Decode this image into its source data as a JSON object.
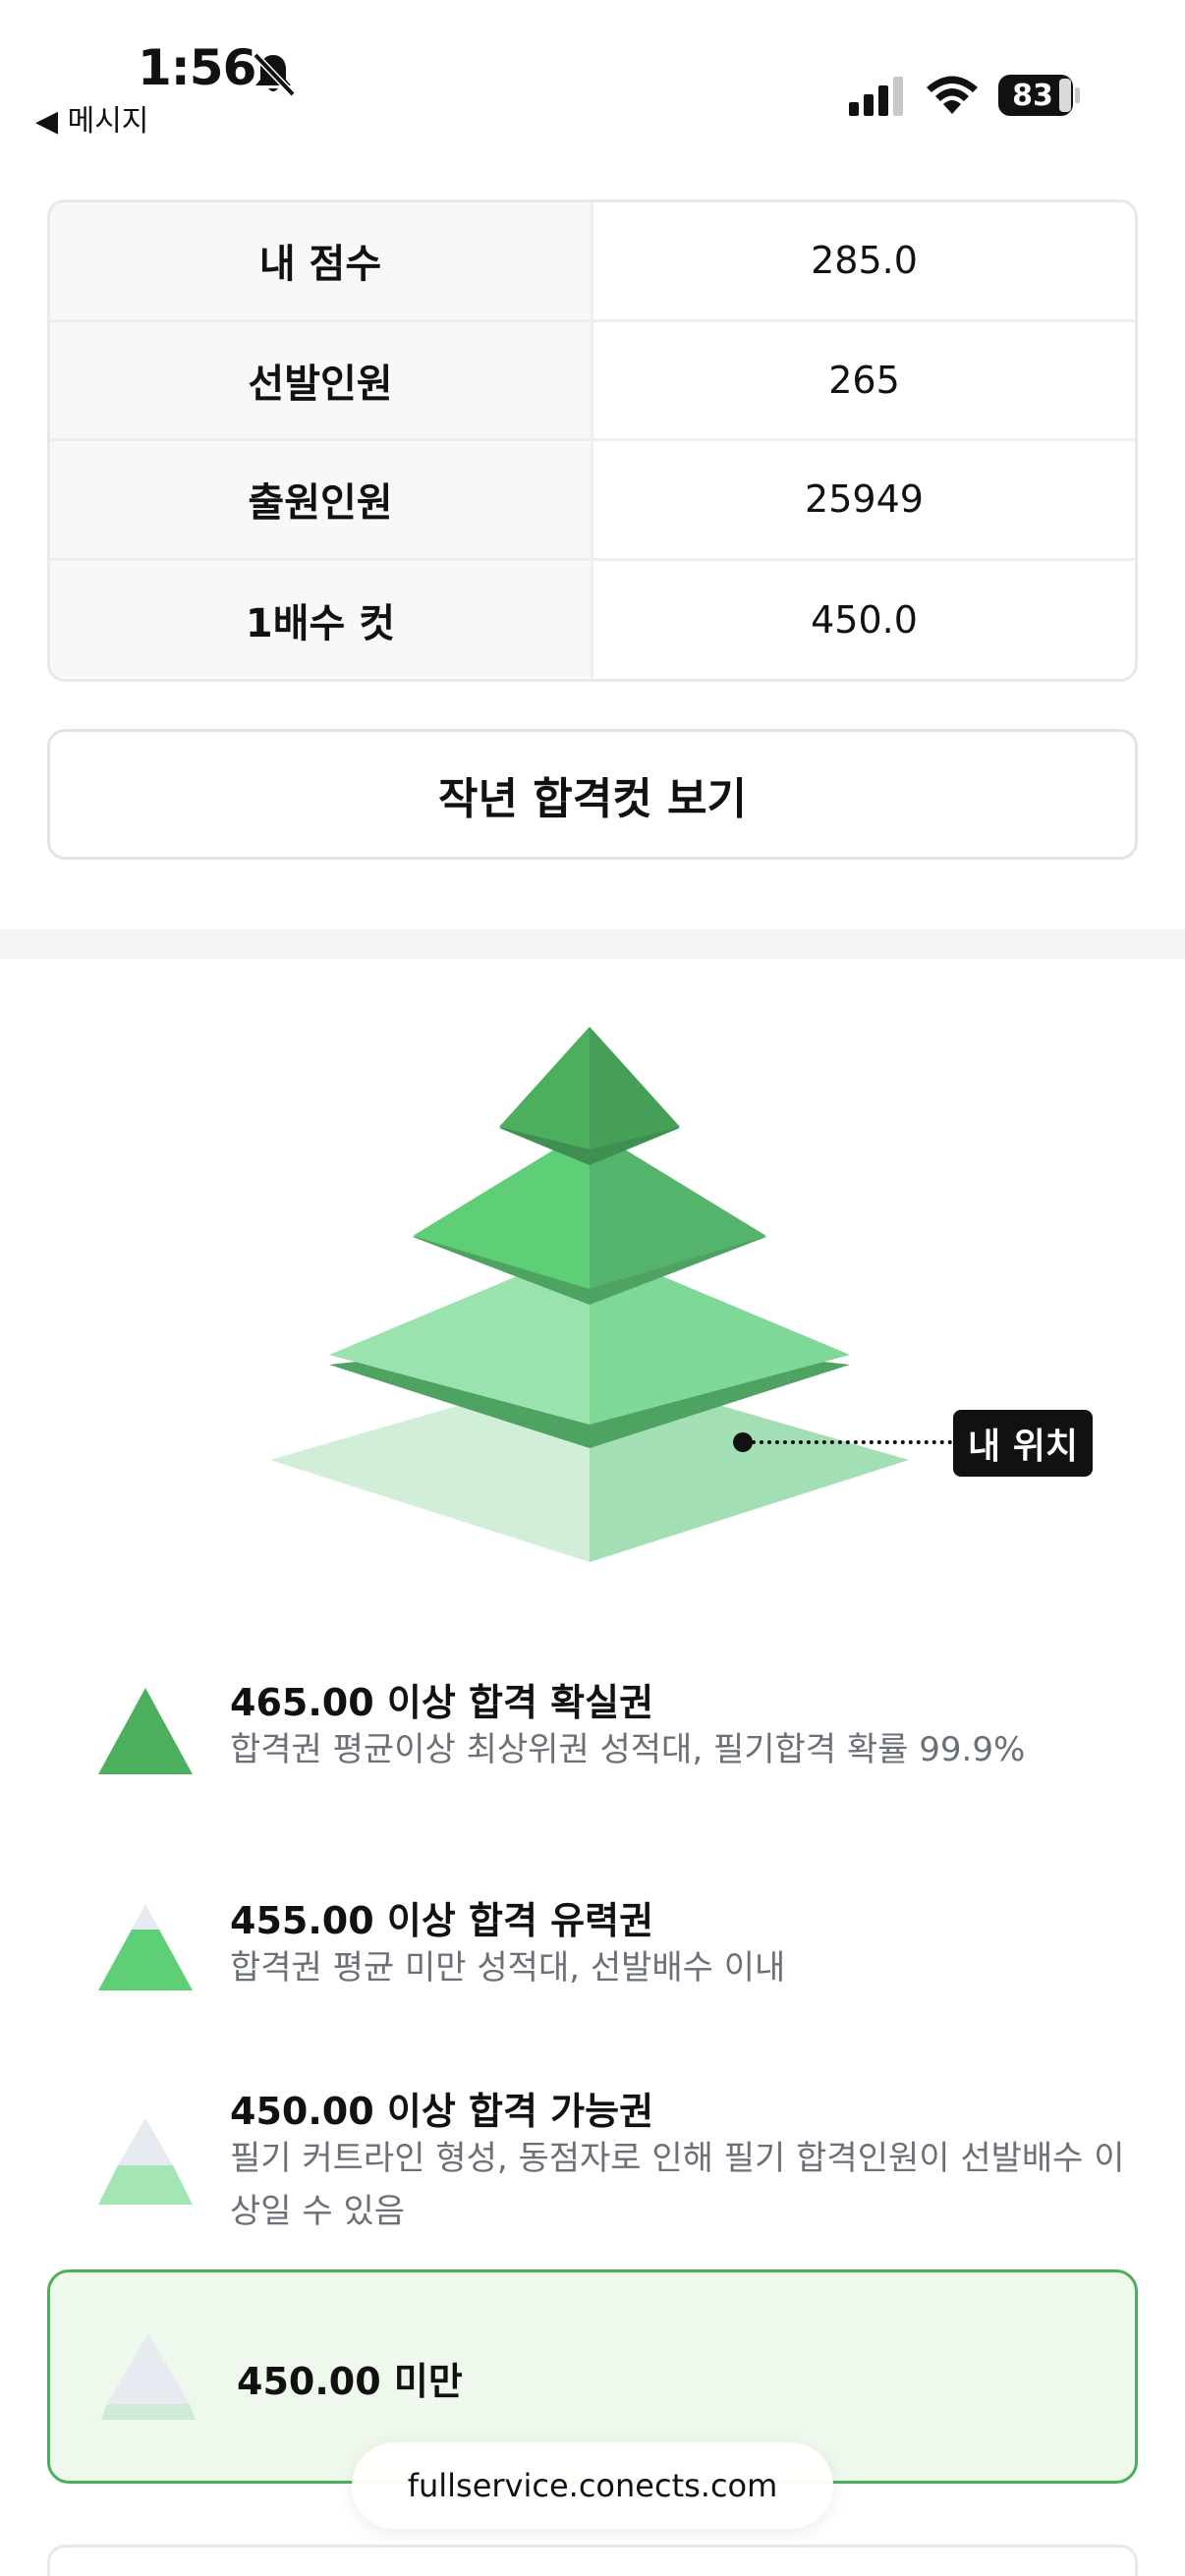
{
  "status_bar": {
    "time": "1:56",
    "back_app": "◀ 메시지",
    "battery": "83"
  },
  "score_table": {
    "rows": [
      {
        "label": "내 점수",
        "value": "285.0"
      },
      {
        "label": "선발인원",
        "value": "265"
      },
      {
        "label": "출원인원",
        "value": "25949"
      },
      {
        "label": "1배수 컷",
        "value": "450.0"
      }
    ]
  },
  "last_year_button": "작년 합격컷 보기",
  "pyramid": {
    "my_position_label": "내 위치",
    "colors": {
      "top": "#4caf5e",
      "upper": "#5ecf76",
      "middle": "#9be3ae",
      "base": "#d1eed9",
      "separator": "#4ea262"
    }
  },
  "legend": [
    {
      "icon": "pyramid-top-tier-icon",
      "title": "465.00 이상 합격 확실권",
      "desc": "합격권 평균이상 최상위권 성적대, 필기합격 확률 99.9%"
    },
    {
      "icon": "pyramid-second-tier-icon",
      "title": "455.00 이상 합격 유력권",
      "desc": "합격권 평균 미만 성적대, 선발배수 이내"
    },
    {
      "icon": "pyramid-third-tier-icon",
      "title": "450.00 이상 합격 가능권",
      "desc": "필기 커트라인 형성, 동점자로 인해 필기 합격인원이 선발배수 이상일 수 있음"
    },
    {
      "icon": "pyramid-base-tier-icon",
      "title": "450.00 미만",
      "desc": ""
    }
  ],
  "url": "fullservice.conects.com"
}
